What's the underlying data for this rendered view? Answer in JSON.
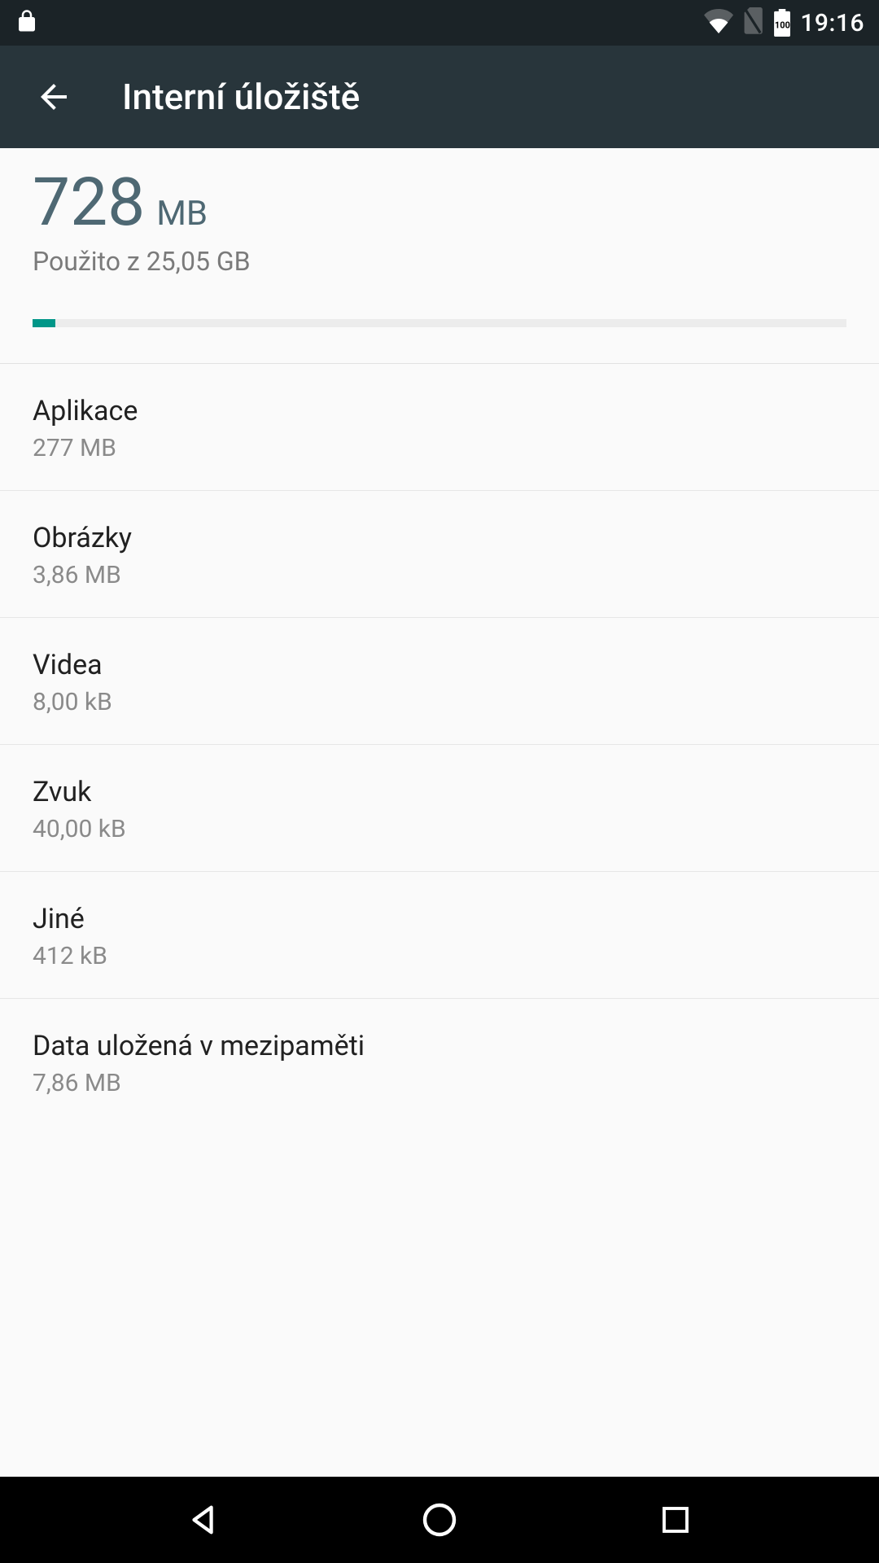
{
  "statusbar": {
    "time": "19:16",
    "battery_level": "100"
  },
  "appbar": {
    "title": "Interní úložiště"
  },
  "summary": {
    "used_value": "728",
    "used_unit": "MB",
    "total_text": "Použito z 25,05 GB",
    "progress_percent": 2.8
  },
  "items": [
    {
      "label": "Aplikace",
      "size": "277 MB"
    },
    {
      "label": "Obrázky",
      "size": "3,86 MB"
    },
    {
      "label": "Videa",
      "size": "8,00 kB"
    },
    {
      "label": "Zvuk",
      "size": "40,00 kB"
    },
    {
      "label": "Jiné",
      "size": "412 kB"
    },
    {
      "label": "Data uložená v mezipaměti",
      "size": "7,86 MB"
    }
  ]
}
